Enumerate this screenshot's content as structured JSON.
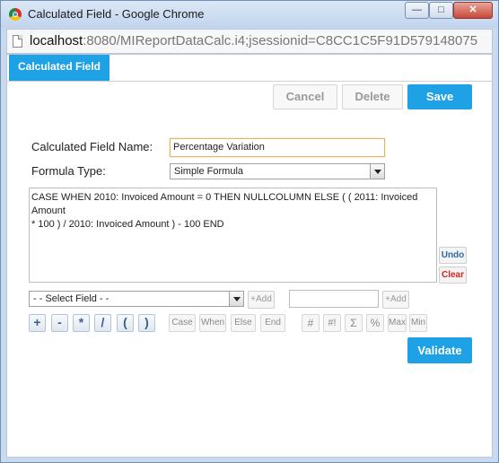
{
  "window": {
    "title": "Calculated Field - Google Chrome",
    "minimize_icon": "minimize-icon",
    "maximize_icon": "maximize-icon",
    "close_icon": "close-icon"
  },
  "addressbar": {
    "host": "localhost",
    "path": ":8080/MIReportDataCalc.i4;jsessionid=C8CC1C5F91D579148075"
  },
  "tab": {
    "label": "Calculated Field"
  },
  "toolbar": {
    "cancel": "Cancel",
    "delete": "Delete",
    "save": "Save"
  },
  "form": {
    "name_label": "Calculated Field Name:",
    "name_value": "Percentage Variation",
    "type_label": "Formula Type:",
    "type_value": "Simple Formula",
    "formula": "CASE WHEN 2010: Invoiced Amount = 0 THEN NULLCOLUMN ELSE ( ( 2011: Invoiced Amount\n* 100 ) / 2010: Invoiced Amount ) - 100 END",
    "undo": "Undo",
    "clear": "Clear",
    "field_select": "- - Select Field - -",
    "add1": "+Add",
    "add2": "+Add"
  },
  "operators": [
    "+",
    "-",
    "*",
    "/",
    "(",
    ")"
  ],
  "keywords": [
    "Case",
    "When",
    "Else",
    "End"
  ],
  "functions": [
    "#",
    "#!",
    "Σ",
    "%",
    "Max",
    "Min"
  ],
  "validate": "Validate",
  "colors": {
    "accent": "#1fa1e6",
    "clear_red": "#d9221c",
    "undo_blue": "#2e6aa7"
  }
}
